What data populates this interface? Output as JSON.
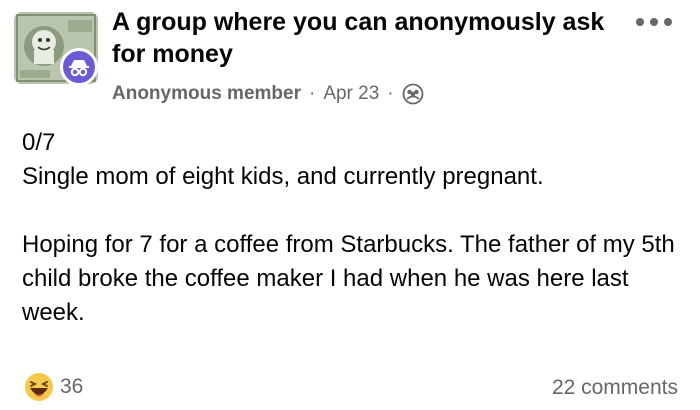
{
  "post": {
    "group_name": "A group where you can anonymously ask for money",
    "author": "Anonymous member",
    "separator": "·",
    "date": "Apr 23",
    "icons": {
      "group_avatar": "money-bill-avatar",
      "anonymous_badge": "anonymous-incognito-icon",
      "privacy": "group-members-icon",
      "more": "more-options-icon",
      "reaction": "haha-emoji-icon"
    },
    "body": {
      "line1": "0/7",
      "line2": "Single mom of eight kids, and currently pregnant.",
      "paragraph2": "Hoping for 7 for a coffee from Starbucks. The father of my 5th child broke the coffee maker I had when he was here last week."
    },
    "reaction_count": "36",
    "comments_label": "22 comments"
  },
  "colors": {
    "badge": "#6b5cd6",
    "meta_text": "#65676b",
    "reaction_yellow": "#f7c94b"
  }
}
